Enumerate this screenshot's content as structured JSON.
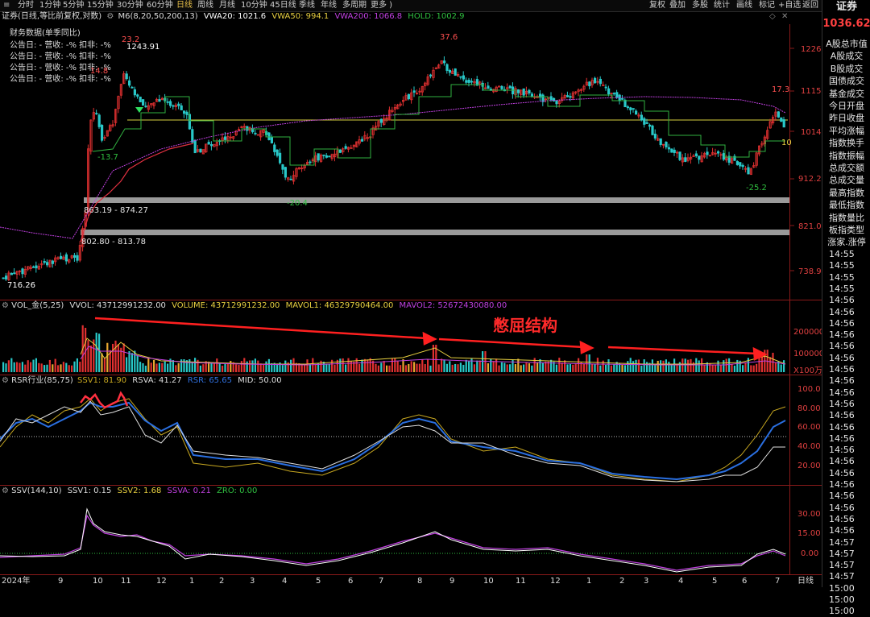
{
  "toolbar": {
    "periods": [
      "分时",
      "1分钟",
      "5分钟",
      "15分钟",
      "30分钟",
      "60分钟",
      "日线",
      "周线",
      "月线",
      "10分钟",
      "45日线",
      "季线",
      "年线",
      "多周期",
      "更多 )"
    ],
    "active": "日线",
    "actions": [
      "复权",
      "叠加",
      "多股",
      "统计",
      "画线",
      "标记",
      "+自选",
      "返回"
    ]
  },
  "main_chart": {
    "title": "证券(日线,等比前复权,对数)",
    "indicator": "M6(8,20,50,200,13)",
    "vwa20": "VWA20: 1021.6",
    "vwa50": "VWA50: 994.1",
    "vwa200": "VWA200: 1066.8",
    "hold": "HOLD: 1002.9",
    "finance_title": "财务数据(单季同比)",
    "finance_rows": [
      "公告日: -   营收: -%   扣非: -%",
      "公告日: -   营收: -%   扣非: -%",
      "公告日: -   营收: -%   扣非: -%",
      "公告日: -   营收: -%   扣非: -%"
    ],
    "y_ticks": [
      "1226",
      "1115",
      "1014",
      "912.2",
      "821.0",
      "738.9"
    ],
    "annotations": {
      "p_23_2": "23.2",
      "p_1243": "1243.91",
      "p_14_8": "14.8",
      "p_m13_7": "-13.7",
      "p_37_6": "37.6",
      "p_m20_4": "-20.4",
      "p_17_3": "17.3",
      "p_m25_2": "-25.2",
      "p_10": "10",
      "p_716": "716.26",
      "band_upper": "863.19 - 874.27",
      "band_lower": "802.80 - 813.78"
    }
  },
  "vol_panel": {
    "title": "VOL_金(5,25)",
    "vvol": "VVOL: 43712991232.00",
    "volume": "VOLUME: 43712991232.00",
    "mavol1": "MAVOL1: 46329790464.00",
    "mavol2": "MAVOL2: 52672430080.00",
    "note": "憋屈结构",
    "y_ticks": [
      "200000",
      "100000",
      "X100万"
    ]
  },
  "rsr_panel": {
    "title": "RSR行业(85,75)",
    "ssv1": "SSV1: 81.90",
    "rsva": "RSVA: 41.27",
    "rsr": "RSR: 65.65",
    "mid": "MID: 50.00",
    "y_ticks": [
      "100.0",
      "80.00",
      "60.00",
      "40.00",
      "20.00"
    ]
  },
  "ssv_panel": {
    "title": "SSV(144,10)",
    "ssv1": "SSV1: 0.15",
    "ssv2": "SSV2: 1.68",
    "ssva": "SSVA: 0.21",
    "zro": "ZRO: 0.00",
    "y_ticks": [
      "30.00",
      "15.00",
      "0.00"
    ]
  },
  "x_axis": {
    "year_label": "2024年",
    "months": [
      "9",
      "10",
      "11",
      "12",
      "1",
      "2",
      "3",
      "4",
      "5",
      "6",
      "7",
      "8",
      "9",
      "10",
      "11",
      "12",
      "1",
      "2",
      "3",
      "4",
      "5",
      "6",
      "7"
    ],
    "period": "日线"
  },
  "right_panel": {
    "name": "证券",
    "price": "1036.62",
    "menu": [
      "A股总市值",
      "A股成交",
      "B股成交",
      "国债成交",
      "基金成交",
      "今日开盘",
      "昨日收盘",
      "平均涨幅",
      "指数换手",
      "指数振幅",
      "总成交额",
      "总成交量",
      "最高指数",
      "最低指数",
      "指数量比",
      "板指类型",
      "涨家.涨停"
    ],
    "times": [
      "14:55",
      "14:55",
      "14:55",
      "14:55",
      "14:56",
      "14:56",
      "14:56",
      "14:56",
      "14:56",
      "14:56",
      "14:56",
      "14:56",
      "14:56",
      "14:56",
      "14:56",
      "14:56",
      "14:56",
      "14:56",
      "14:56",
      "14:56",
      "14:56",
      "14:56",
      "14:56",
      "14:56",
      "14:56",
      "14:57",
      "14:57",
      "14:57",
      "14:57",
      "15:00",
      "15:00",
      "15:00"
    ]
  },
  "colors": {
    "up": "#e03030",
    "down": "#28c8c8",
    "yellow": "#e8d040",
    "magenta": "#c040e0",
    "green": "#30c040",
    "blue": "#3070e0",
    "grid": "#5a1a1a"
  }
}
